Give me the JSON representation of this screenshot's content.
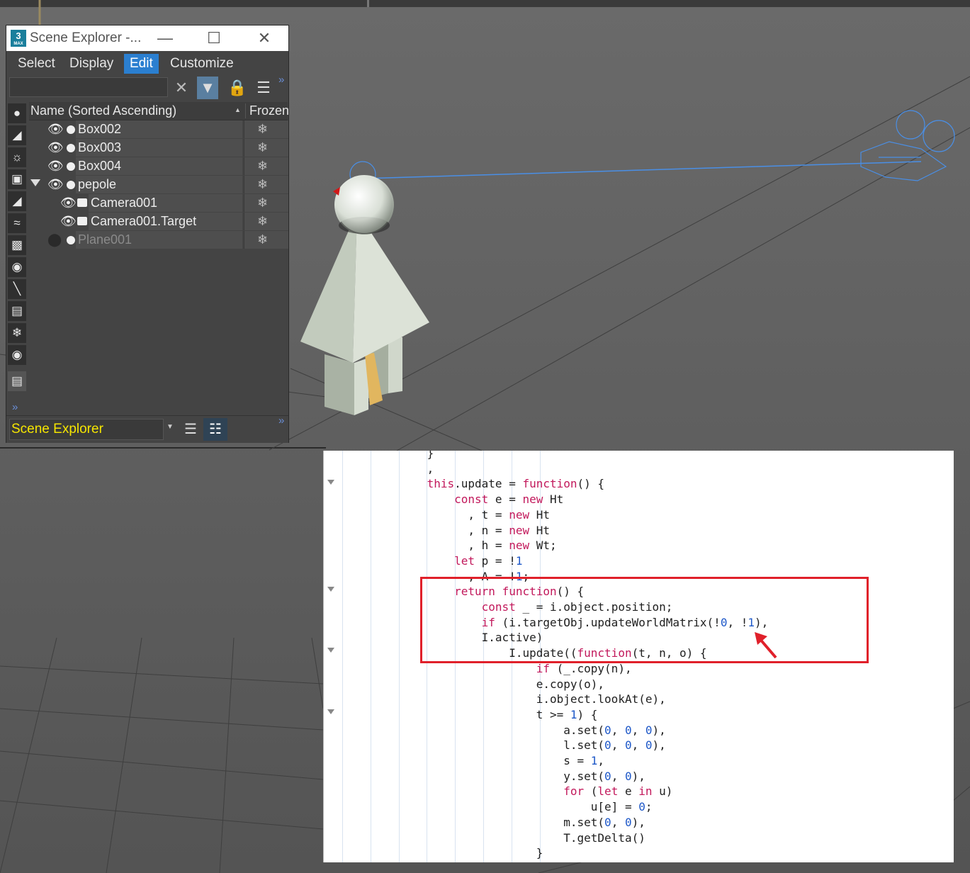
{
  "scene_explorer": {
    "title": "Scene Explorer -...",
    "app_icon_text": "3",
    "app_icon_sub": "MAX",
    "menu": [
      "Select",
      "Display",
      "Edit",
      "Customize"
    ],
    "active_menu": "Edit",
    "search_value": "",
    "columns": {
      "name": "Name (Sorted Ascending)",
      "frozen": "Frozen"
    },
    "tree": [
      {
        "label": "Box002",
        "icon": "sphere-icon",
        "visible": true
      },
      {
        "label": "Box003",
        "icon": "sphere-icon",
        "visible": true
      },
      {
        "label": "Box004",
        "icon": "sphere-icon",
        "visible": true
      },
      {
        "label": "pepole",
        "icon": "sphere-icon",
        "visible": true,
        "expanded": true
      },
      {
        "label": "Camera001",
        "icon": "camera-icon",
        "visible": true
      },
      {
        "label": "Camera001.Target",
        "icon": "camera-icon",
        "visible": true
      },
      {
        "label": "Plane001",
        "icon": "sphere-icon",
        "visible": false
      }
    ],
    "bottom_combo": "Scene Explorer",
    "left_toolbar_icons": [
      "geometry-icon",
      "shapes-icon",
      "lights-icon",
      "cameras-icon",
      "helpers-icon",
      "spacewarps-icon",
      "groups-icon",
      "xrefs-icon",
      "bones-icon",
      "containers-icon",
      "frozen-icon",
      "hidden-icon",
      "display-all-icon"
    ]
  },
  "code": {
    "lines": [
      "            }",
      "            ,",
      "            this.update = function() {",
      "                const e = new Ht",
      "                  , t = new Ht",
      "                  , n = new Ht",
      "                  , h = new Wt;",
      "                let p = !1",
      "                  , A = !1;",
      "                return function() {",
      "                    const _ = i.object.position;",
      "                    if (i.targetObj.updateWorldMatrix(!0, !1),",
      "                    I.active)",
      "                        I.update((function(t, n, o) {",
      "                            if (_.copy(n),",
      "                            e.copy(o),",
      "                            i.object.lookAt(e),",
      "                            t >= 1) {",
      "                                a.set(0, 0, 0),",
      "                                l.set(0, 0, 0),",
      "                                s = 1,",
      "                                y.set(0, 0),",
      "                                for (let e in u)",
      "                                    u[e] = 0;",
      "                                m.set(0, 0),",
      "                                T.getDelta()",
      "                            }",
      "                            ;"
    ]
  }
}
